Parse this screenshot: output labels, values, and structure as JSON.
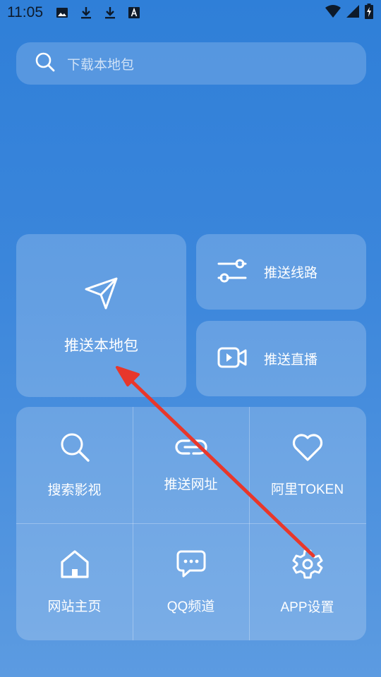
{
  "status_bar": {
    "time": "11:05",
    "icons": [
      "image-icon",
      "download-icon",
      "download-icon",
      "font-a-icon"
    ],
    "right_icons": [
      "wifi-icon",
      "signal-icon",
      "battery-charging-icon"
    ]
  },
  "search": {
    "placeholder": "下载本地包",
    "icon": "search-icon"
  },
  "main_card": {
    "label": "推送本地包",
    "icon": "send-icon"
  },
  "side_cards": [
    {
      "label": "推送线路",
      "icon": "sliders-icon"
    },
    {
      "label": "推送直播",
      "icon": "video-icon"
    }
  ],
  "grid": [
    {
      "label": "搜索影视",
      "icon": "search-icon"
    },
    {
      "label": "推送网址",
      "icon": "link-icon"
    },
    {
      "label": "阿里TOKEN",
      "icon": "heart-icon"
    },
    {
      "label": "网站主页",
      "icon": "home-icon"
    },
    {
      "label": "QQ频道",
      "icon": "chat-icon"
    },
    {
      "label": "APP设置",
      "icon": "gear-icon"
    }
  ],
  "colors": {
    "background_top": "#2f7fd8",
    "background_bottom": "#5c9be1",
    "annotation_arrow": "#e8372b"
  }
}
